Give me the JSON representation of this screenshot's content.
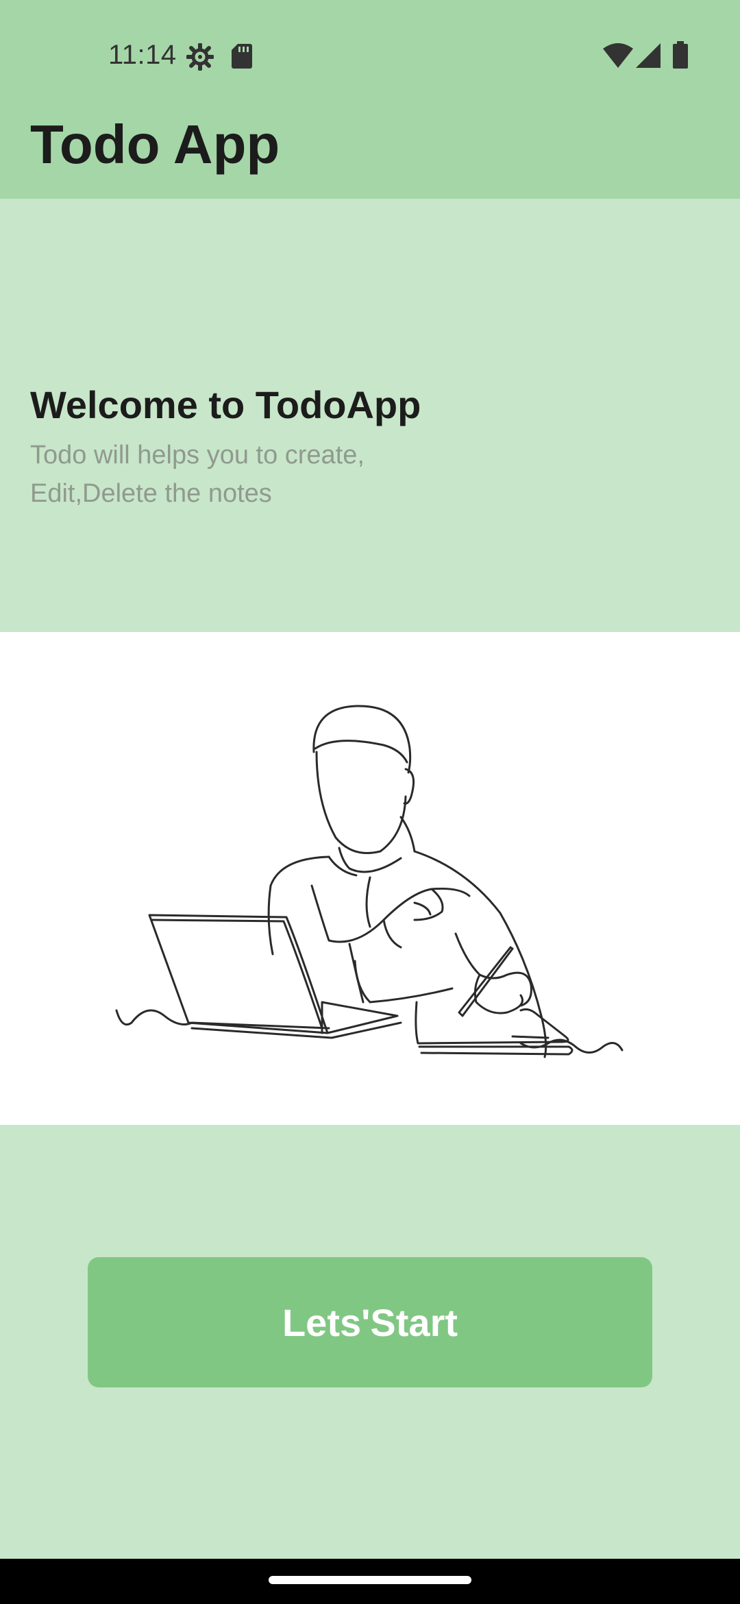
{
  "status_bar": {
    "time": "11:14",
    "icons": [
      "settings-gear-icon",
      "sd-card-icon",
      "wifi-icon",
      "cell-signal-icon",
      "battery-icon"
    ]
  },
  "app_bar": {
    "title": "Todo App"
  },
  "welcome": {
    "title": "Welcome to TodoApp",
    "subtitle": "Todo will helps you to create, Edit,Delete the notes"
  },
  "illustration": {
    "icon": "man-writing-at-laptop-line-drawing"
  },
  "actions": {
    "start_label": "Lets'Start"
  },
  "colors": {
    "app_bar": "#a5d6a7",
    "background": "#c8e6c9",
    "button": "#81c784"
  }
}
